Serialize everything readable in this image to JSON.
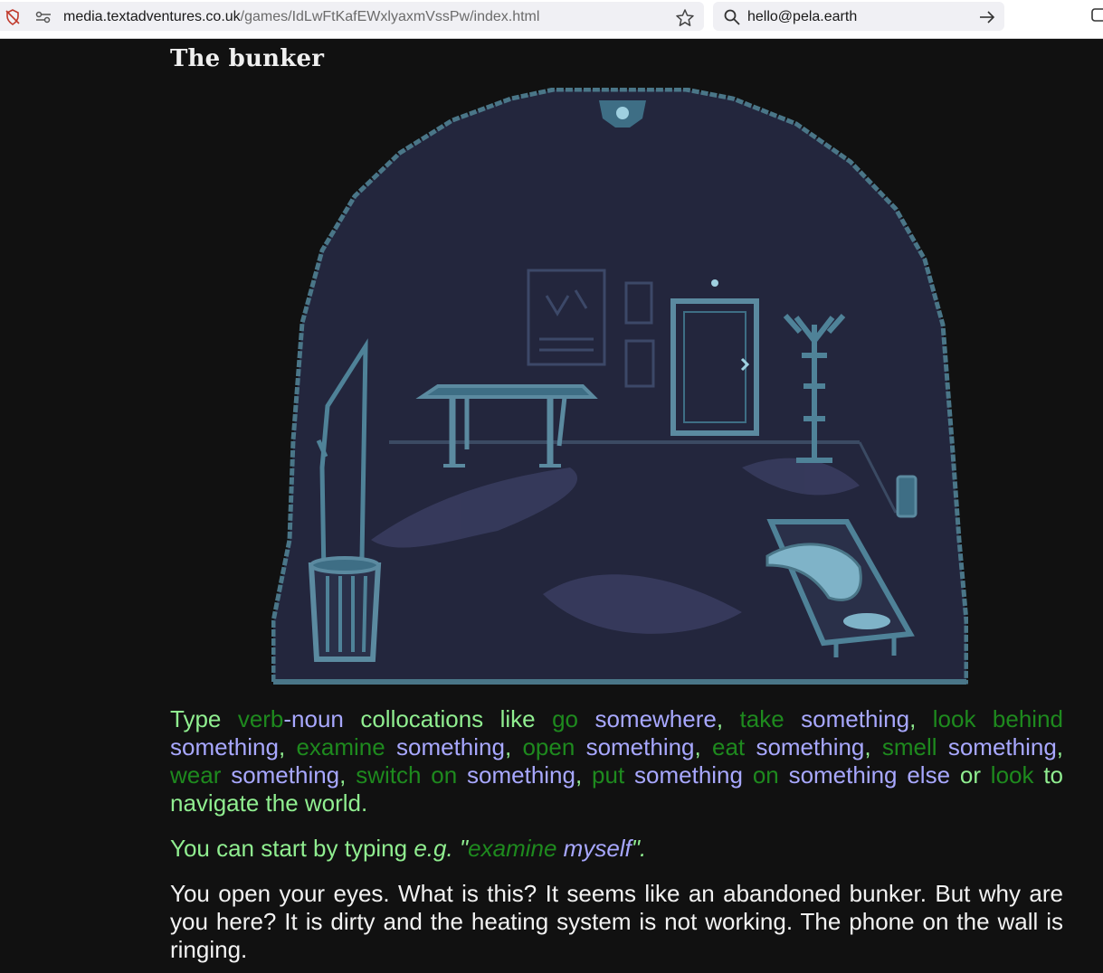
{
  "browser": {
    "url_host": "media.textadventures.co.uk",
    "url_path": "/games/IdLwFtKafEWxlyaxmVssPw/index.html",
    "search_value": "hello@pela.earth",
    "icons": [
      "tracking-protection-icon",
      "site-permissions-icon",
      "bookmark-star-icon",
      "search-icon",
      "go-arrow-icon",
      "extension-icon"
    ]
  },
  "game": {
    "room_title": "The bunker",
    "scene_image": "pixel-art-bunker-room",
    "instructions": [
      {
        "t": "Type ",
        "c": "l"
      },
      {
        "t": "verb",
        "c": "v"
      },
      {
        "t": "-noun",
        "c": "n"
      },
      {
        "t": " collocations like ",
        "c": "l"
      },
      {
        "t": "go",
        "c": "v"
      },
      {
        "t": " ",
        "c": "l"
      },
      {
        "t": "somewhere",
        "c": "n"
      },
      {
        "t": ", ",
        "c": "l"
      },
      {
        "t": "take",
        "c": "v"
      },
      {
        "t": " ",
        "c": "l"
      },
      {
        "t": "something",
        "c": "n"
      },
      {
        "t": ", ",
        "c": "l"
      },
      {
        "t": "look behind",
        "c": "v"
      },
      {
        "t": " ",
        "c": "l"
      },
      {
        "t": "something",
        "c": "n"
      },
      {
        "t": ", ",
        "c": "l"
      },
      {
        "t": "examine",
        "c": "v"
      },
      {
        "t": " ",
        "c": "l"
      },
      {
        "t": "something",
        "c": "n"
      },
      {
        "t": ", ",
        "c": "l"
      },
      {
        "t": "open",
        "c": "v"
      },
      {
        "t": " ",
        "c": "l"
      },
      {
        "t": "something",
        "c": "n"
      },
      {
        "t": ", ",
        "c": "l"
      },
      {
        "t": "eat",
        "c": "v"
      },
      {
        "t": " ",
        "c": "l"
      },
      {
        "t": "something",
        "c": "n"
      },
      {
        "t": ", ",
        "c": "l"
      },
      {
        "t": "smell",
        "c": "v"
      },
      {
        "t": " ",
        "c": "l"
      },
      {
        "t": "something",
        "c": "n"
      },
      {
        "t": ", ",
        "c": "l"
      },
      {
        "t": "wear",
        "c": "v"
      },
      {
        "t": " ",
        "c": "l"
      },
      {
        "t": "something",
        "c": "n"
      },
      {
        "t": ", ",
        "c": "l"
      },
      {
        "t": "switch on",
        "c": "v"
      },
      {
        "t": " ",
        "c": "l"
      },
      {
        "t": "something",
        "c": "n"
      },
      {
        "t": ", ",
        "c": "l"
      },
      {
        "t": "put",
        "c": "v"
      },
      {
        "t": " ",
        "c": "l"
      },
      {
        "t": "something",
        "c": "n"
      },
      {
        "t": " ",
        "c": "l"
      },
      {
        "t": "on",
        "c": "v"
      },
      {
        "t": " ",
        "c": "l"
      },
      {
        "t": "something else",
        "c": "n"
      },
      {
        "t": " or ",
        "c": "l"
      },
      {
        "t": "look",
        "c": "v"
      },
      {
        "t": " to navigate the world.",
        "c": "l"
      }
    ],
    "hint": {
      "prefix": "You can start by typing ",
      "eg": "e.g.",
      "open_quote": " \"",
      "verb": "examine",
      "noun": " myself",
      "close": "\"."
    },
    "description": "You open your eyes. What is this? It seems like an abandoned bunker. But why are you here? It is dirty and the heating system is not working. The phone on the wall is ringing."
  },
  "colors": {
    "background": "#111111",
    "text_default": "#90ee90",
    "verb": "#1e8a1e",
    "noun": "#a8a8ff",
    "description": "#f2f2f2",
    "scene_fill": "#23263d",
    "scene_outline": "#4a7688"
  }
}
